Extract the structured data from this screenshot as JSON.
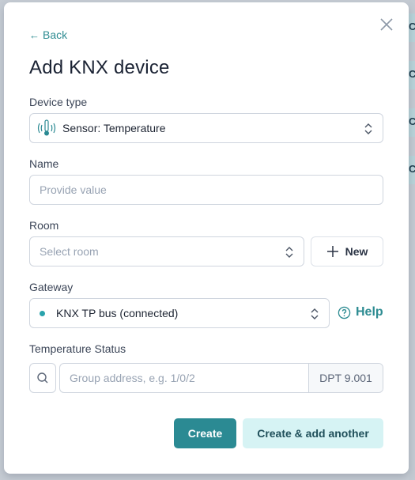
{
  "background": {
    "row_letters": [
      "C",
      "C",
      "C",
      "C"
    ]
  },
  "modal": {
    "back_label": "Back",
    "title": "Add KNX device",
    "close_icon": "close-icon"
  },
  "form": {
    "device_type": {
      "label": "Device type",
      "value": "Sensor: Temperature",
      "icon": "thermometer-signal-icon"
    },
    "name": {
      "label": "Name",
      "placeholder": "Provide value",
      "value": ""
    },
    "room": {
      "label": "Room",
      "placeholder": "Select room",
      "new_button_label": "New"
    },
    "gateway": {
      "label": "Gateway",
      "value": "KNX TP bus (connected)",
      "status_color": "#2aa3ac",
      "help_label": "Help"
    },
    "temperature_status": {
      "label": "Temperature Status",
      "placeholder": "Group address, e.g. 1/0/2",
      "value": "",
      "dpt": "DPT 9.001"
    }
  },
  "actions": {
    "create_label": "Create",
    "create_another_label": "Create & add another"
  },
  "colors": {
    "accent": "#2b8a93",
    "accent_light": "#d6f3f4"
  }
}
